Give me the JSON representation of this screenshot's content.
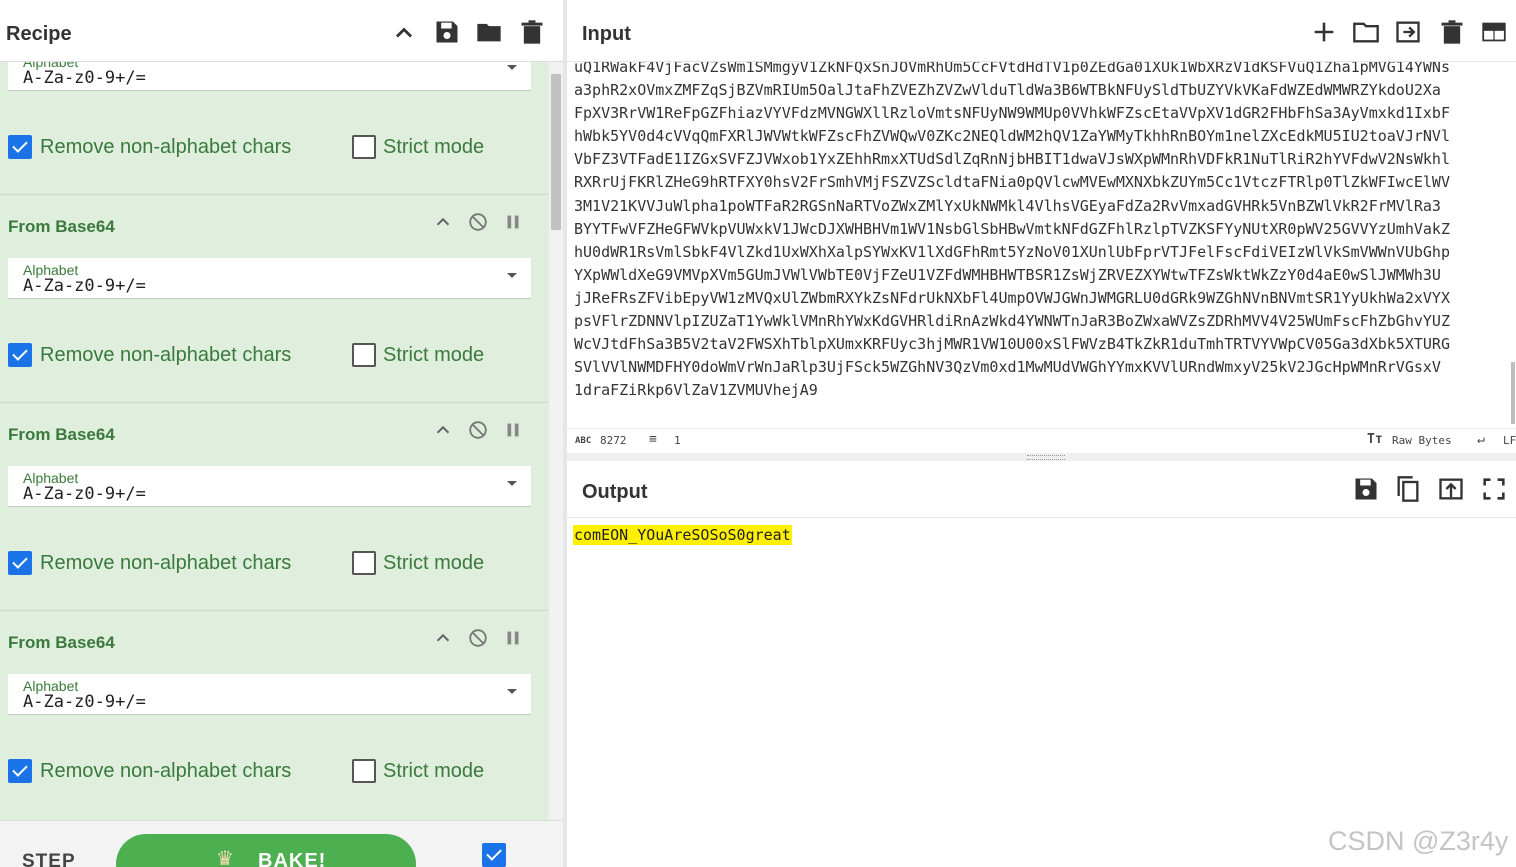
{
  "recipe": {
    "title": "Recipe",
    "header_icons": [
      "chevron-up-icon",
      "save-icon",
      "folder-icon",
      "trash-icon"
    ],
    "top_partial": {
      "label": "Alphabet",
      "value": "A-Za-z0-9+/=",
      "remove_label": "Remove non-alphabet chars",
      "remove_checked": true,
      "strict_label": "Strict mode",
      "strict_checked": false
    },
    "operations": [
      {
        "name": "From Base64",
        "alphabet_label": "Alphabet",
        "alphabet_value": "A-Za-z0-9+/=",
        "remove_label": "Remove non-alphabet chars",
        "remove_checked": true,
        "strict_label": "Strict mode",
        "strict_checked": false
      },
      {
        "name": "From Base64",
        "alphabet_label": "Alphabet",
        "alphabet_value": "A-Za-z0-9+/=",
        "remove_label": "Remove non-alphabet chars",
        "remove_checked": true,
        "strict_label": "Strict mode",
        "strict_checked": false
      },
      {
        "name": "From Base64",
        "alphabet_label": "Alphabet",
        "alphabet_value": "A-Za-z0-9+/=",
        "remove_label": "Remove non-alphabet chars",
        "remove_checked": true,
        "strict_label": "Strict mode",
        "strict_checked": false
      }
    ],
    "step_label": "STEP",
    "bake_label": "BAKE!",
    "auto_bake_checked": true
  },
  "input": {
    "title": "Input",
    "header_icons": [
      "plus-icon",
      "folder-icon",
      "import-icon",
      "trash-icon",
      "layout-icon"
    ],
    "lines": [
      "uQ1RWakF4VjFacVZsWm1SMmgyV1ZkNFQxSnJOVmRhUm5CcFVtdHdTV1p0ZEdGa01XUk1WbXRzV1dKSFVuQ1Zha1pMVG14YWNs",
      "a3phR2xOVmxZMFZqSjBZVmRIUm5OalJtaFhZVEZhZVZwVlduTldWa3B6WTBkNFUySldTbUZYVkVKaFdWZEdWMWRZYkdoU2Xa",
      "FpXV3RrVW1ReFpGZFhiazVYVFdzMVNGWXllRzloVmtsNFUyNW9WMUp0VVhkWFZscEtaVVpXV1dGR2FHbFhSa3AyVmxkd1IxbF",
      "hWbk5YV0d4cVVqQmFXRlJWVWtkWFZscFhZVWQwV0ZKc2NEQldWM2hQV1ZaYWMyTkhhRnBOYm1nelZXcEdkMU5IU2toaVJrNVl",
      "VbFZ3VTFadE1IZGxSVFZJVWxob1YxZEhhRmxXTUdSdlZqRnNjbHBIT1dwaVJsWXpWMnRhVDFkR1NuTlRiR2hYVFdwV2NsWkhl",
      "RXRrUjFKRlZHeG9hRTFXY0hsV2FrSmhVMjFSZVZScldtaFNia0pQVlcwMVEwMXNXbkZUYm5Cc1VtczFTRlp0TlZkWFIwcElWV",
      "3M1V21KVVJuWlpha1poWTFaR2RGSnNaRTVoZWxZMlYxUkNWMkl4VlhsVGEyaFdZa2RvVmxadGVHRk5VnBZWlVkR2FrMVlRa3",
      "BYYTFwVFZHeGFWVkpVUWxkV1JWcDJXWHBHVm1WV1NsbGlSbHBwVmtkNFdGZFhlRzlpTVZKSFYyNUtXR0pWV25GVVYzUmhVakZ",
      "hU0dWR1RsVmlSbkF4VlZkd1UxWXhXalpSYWxKV1lXdGFhRmt5YzNoV01XUnlUbFprVTJFelFscFdiVEIzWlVkSmVWWnVUbGhp",
      "YXpWWldXeG9VMVpXVm5GUmJVWlVWbTE0VjFZeU1VZFdWMHBHWTBSR1ZsWjZRVEZXYWtwTFZsWktWkZzY0d4aE0wSlJWMWh3U",
      "jJReFRsZFVibEpyVW1zMVQxUlZWbmRXYkZsNFdrUkNXbFl4UmpOVWJGWnJWMGRLU0dGRk9WZGhNVnBNVmtSR1YyUkhWa2xVYX",
      "psVFlrZDNNVlpIZUZaT1YwWklVMnRhYWxKdGVHRldiRnAzWkd4YWNWTnJaR3BoZWxaWVZsZDRhMVV4V25WUmFscFhZbGhvYUZ",
      "WcVJtdFhSa3B5V2taV2FWSXhTblpXUmxKRFUyc3hjMWR1VW10U00xSlFWVzB4TkZkR1duTmhTRTVYVWpCV05Ga3dXbk5XTURG",
      "SVlVVlNWMDFHY0doWmVrWnJaRlp3UjFSck5WZGhNV3QzVm0xd1MwMUdVWGhYYmxKVVlURndWmxyV25kV2JGcHpWMnRrVGsxV",
      "1draFZiRkp6VlZaV1ZVMUVhejA9"
    ],
    "char_count": "8272",
    "line_count": "1",
    "raw_bytes_label": "Raw Bytes",
    "eol_label": "LF"
  },
  "output": {
    "title": "Output",
    "header_icons": [
      "save-icon",
      "copy-icon",
      "replace-input-icon",
      "fullscreen-icon"
    ],
    "value": "comEON_YOuAreSOSoS0great"
  },
  "watermark": "CSDN @Z3r4y",
  "colors": {
    "recipe_bg": "#dfeedd",
    "accent_green": "#3a7a3c",
    "bake_green": "#4caf50",
    "checkbox_blue": "#1a73e8",
    "highlight_yellow": "#fff000"
  }
}
